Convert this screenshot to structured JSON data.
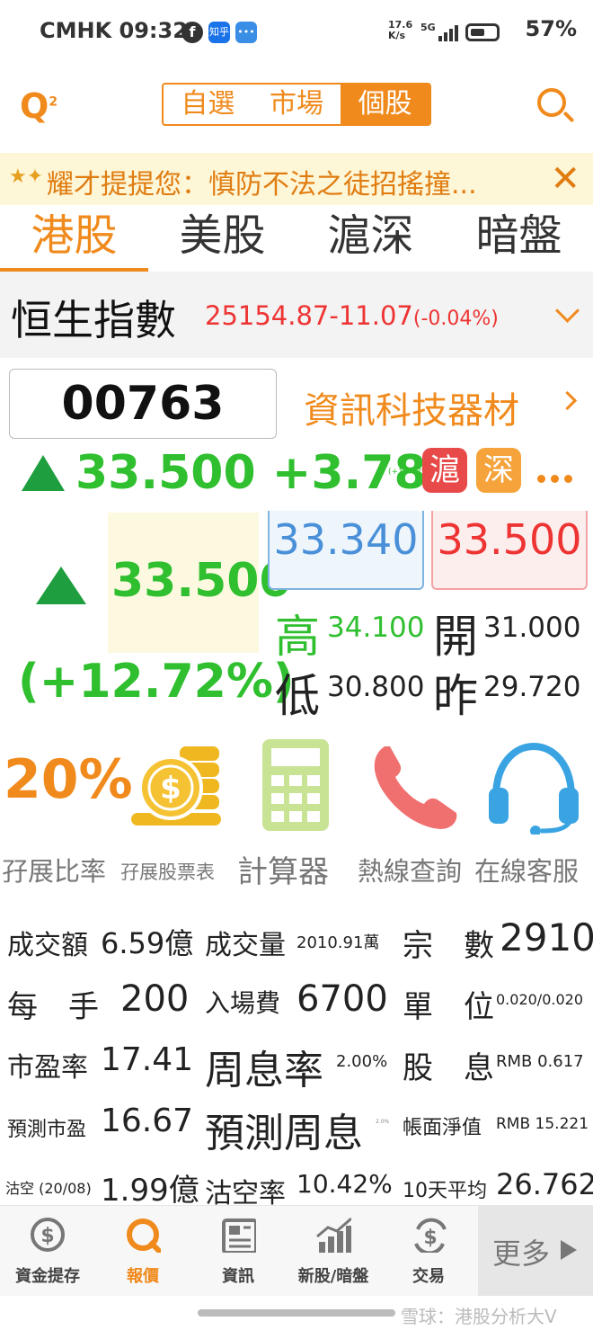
{
  "status_bar": {
    "carrier_time": "CMHK 09:32",
    "app_icon_zhihu": "知乎",
    "net_speed_top": "17.6",
    "net_speed_unit": "K/s",
    "signal": "5G",
    "battery": "57%"
  },
  "header": {
    "logo": "Q",
    "logo_sup": "2",
    "segments": [
      "自選",
      "市場",
      "個股"
    ],
    "active_segment": "個股"
  },
  "notice": {
    "text": "耀才提提您：慎防不法之徒招搖撞...",
    "close": "✕"
  },
  "market_tabs": [
    "港股",
    "美股",
    "滬深",
    "暗盤"
  ],
  "index": {
    "name": "恒生指數",
    "value": "25154.87",
    "change": "-11.07",
    "pct": "(-0.04%)"
  },
  "stock": {
    "code": "00763",
    "sector": "資訊科技器材",
    "price": "33.500",
    "change": "+3.780",
    "change_pct_small": "(+12.72%)",
    "badge_sh": "滬",
    "badge_sz": "深",
    "big_price": "33.500",
    "big_pct": "(+12.72%)",
    "bid": "33.340",
    "ask": "33.500",
    "high_label": "高",
    "high": "34.100",
    "open_label": "開",
    "open": "31.000",
    "low_label": "低",
    "low": "30.800",
    "prev_label": "昨",
    "prev": "29.720"
  },
  "tools": {
    "percent": "20%",
    "labels": [
      "孖展比率",
      "孖展股票表",
      "計算器",
      "熱線查詢",
      "在線客服"
    ]
  },
  "stats": {
    "turnover_label": "成交額",
    "turnover": "6.59億",
    "volume_label": "成交量",
    "volume": "2010.91萬",
    "trades_label": "宗　數",
    "trades": "2910",
    "lot_label": "每　手",
    "lot": "200",
    "entry_label": "入場費",
    "entry": "6700",
    "spread_label": "單　位",
    "spread": "0.020/0.020",
    "pe_label": "市盈率",
    "pe": "17.41",
    "yield_label": "周息率",
    "yield": "2.00%",
    "div_label": "股　息",
    "div": "RMB 0.617",
    "fpe_label": "預測市盈",
    "fpe": "16.67",
    "fyield_label": "預測周息",
    "fyield": "2.0%",
    "nav_label": "帳面淨值",
    "nav": "RMB 15.221",
    "short_label": "沽空 (20/08)",
    "short": "1.99億",
    "short_ratio_label": "沽空率",
    "short_ratio": "10.42%",
    "avg10_label": "10天平均",
    "avg10": "26.762"
  },
  "bottom_nav": {
    "items": [
      "資金提存",
      "報價",
      "資訊",
      "新股/暗盤",
      "交易"
    ],
    "active": "報價",
    "more": "更多"
  },
  "watermark": "雪球：港股分析大V",
  "colors": {
    "accent": "#f08a1c",
    "up_green": "#2fbf2f",
    "down_red": "#e33333",
    "bid_blue": "#4a90d9"
  }
}
